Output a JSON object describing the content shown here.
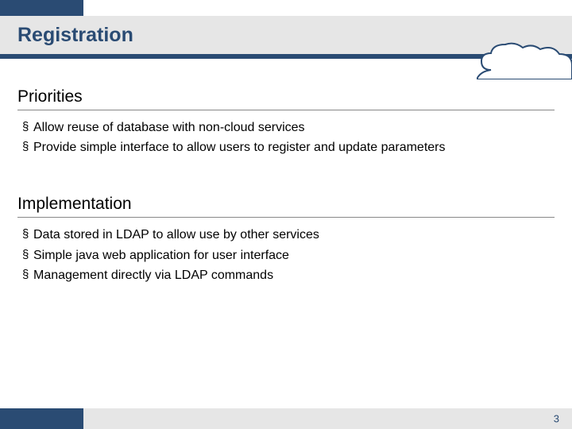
{
  "title": "Registration",
  "sections": [
    {
      "heading": "Priorities",
      "items": [
        "Allow reuse of database with non-cloud services",
        "Provide simple interface to allow users to register and update parameters"
      ]
    },
    {
      "heading": "Implementation",
      "items": [
        "Data stored in LDAP to allow use by other services",
        "Simple java web application for user interface",
        "Management directly via LDAP commands"
      ]
    }
  ],
  "page_number": "3"
}
